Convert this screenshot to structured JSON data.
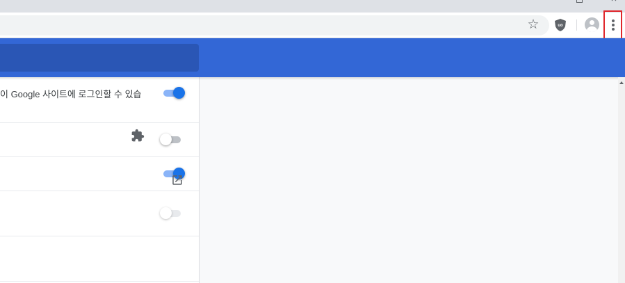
{
  "window": {
    "close_glyph": "×"
  },
  "toolbar": {
    "bookmark_glyph": "☆",
    "menu_highlight_color": "#e0262b"
  },
  "header": {
    "accent_color": "#3367d6"
  },
  "settings": {
    "rows": [
      {
        "label": "이 Google 사이트에 로그인할 수 있습",
        "toggle": "on"
      },
      {
        "label": "",
        "toggle": "off"
      },
      {
        "label": "",
        "toggle": "on"
      },
      {
        "label": "",
        "toggle": "off-disabled",
        "icon": "puzzle-icon"
      },
      {
        "label": "",
        "icon": "external-link-icon"
      }
    ]
  }
}
